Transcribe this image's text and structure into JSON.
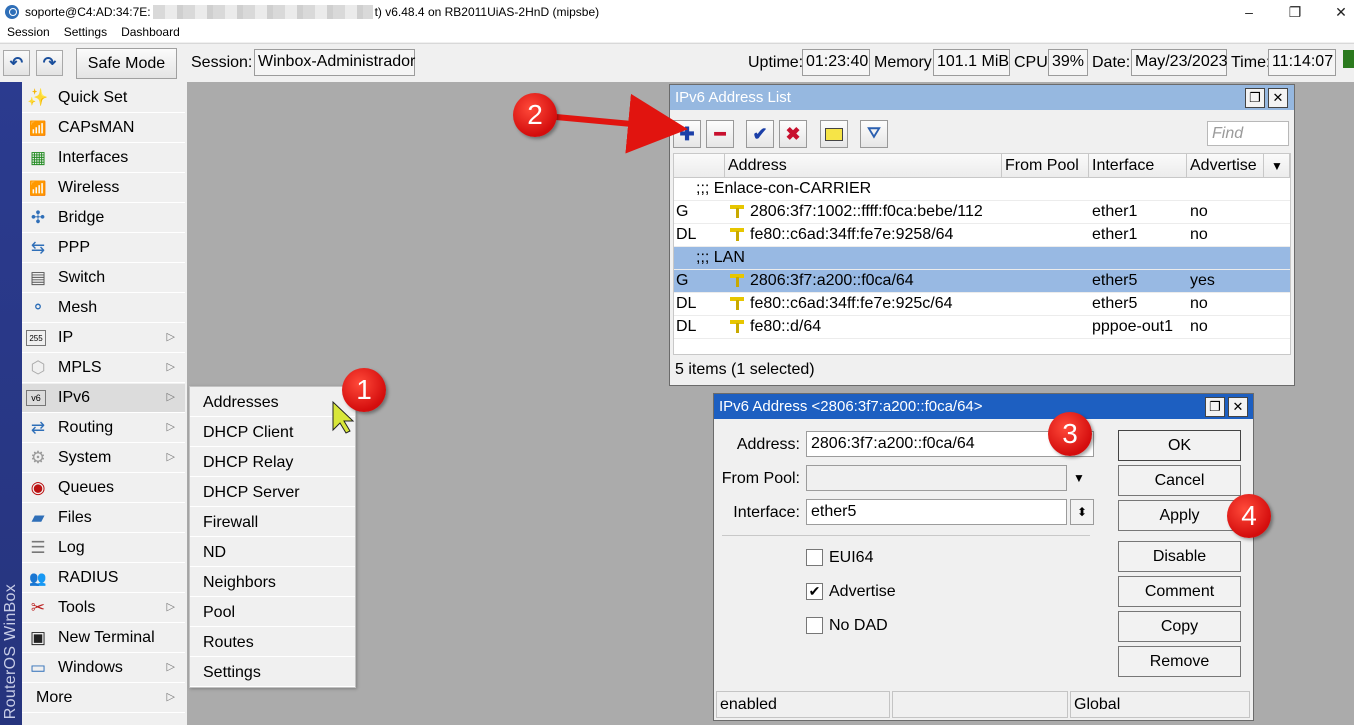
{
  "window": {
    "title_prefix": "soporte@C4:AD:34:7E:",
    "title_suffix": "t) v6.48.4 on RB2011UiAS-2HnD (mipsbe)",
    "minimize": "–",
    "maximize": "❐",
    "close": "✕"
  },
  "menubar": {
    "items": [
      "Session",
      "Settings",
      "Dashboard"
    ]
  },
  "toolbar": {
    "undo_icon": "↶",
    "redo_icon": "↷",
    "safe_mode": "Safe Mode",
    "session_label": "Session:",
    "session_value": "Winbox-Administrador",
    "uptime_label": "Uptime:",
    "uptime_value": "01:23:40",
    "memory_label": "Memory:",
    "memory_value": "101.1 MiB",
    "cpu_label": "CPU:",
    "cpu_value": "39%",
    "date_label": "Date:",
    "date_value": "May/23/2023",
    "time_label": "Time:",
    "time_value": "11:14:07"
  },
  "brand": "RouterOS WinBox",
  "sidebar": {
    "items": [
      {
        "label": "Quick Set",
        "icon": "wand-icon",
        "glyph": "✨",
        "submenu": false
      },
      {
        "label": "CAPsMAN",
        "icon": "capsman-icon",
        "glyph": "📶",
        "submenu": false
      },
      {
        "label": "Interfaces",
        "icon": "interfaces-icon",
        "glyph": "▦",
        "submenu": false
      },
      {
        "label": "Wireless",
        "icon": "wireless-icon",
        "glyph": "📶",
        "submenu": false
      },
      {
        "label": "Bridge",
        "icon": "bridge-icon",
        "glyph": "✣",
        "submenu": false
      },
      {
        "label": "PPP",
        "icon": "ppp-icon",
        "glyph": "⇆",
        "submenu": false
      },
      {
        "label": "Switch",
        "icon": "switch-icon",
        "glyph": "▤",
        "submenu": false
      },
      {
        "label": "Mesh",
        "icon": "mesh-icon",
        "glyph": "⚬",
        "submenu": false
      },
      {
        "label": "IP",
        "icon": "ip-icon",
        "glyph": "255",
        "submenu": true
      },
      {
        "label": "MPLS",
        "icon": "mpls-icon",
        "glyph": "⬡",
        "submenu": true
      },
      {
        "label": "IPv6",
        "icon": "ipv6-icon",
        "glyph": "v6",
        "submenu": true
      },
      {
        "label": "Routing",
        "icon": "routing-icon",
        "glyph": "⇄",
        "submenu": true
      },
      {
        "label": "System",
        "icon": "gear-icon",
        "glyph": "⚙",
        "submenu": true
      },
      {
        "label": "Queues",
        "icon": "queues-icon",
        "glyph": "◉",
        "submenu": false
      },
      {
        "label": "Files",
        "icon": "folder-icon",
        "glyph": "▰",
        "submenu": false
      },
      {
        "label": "Log",
        "icon": "log-icon",
        "glyph": "☰",
        "submenu": false
      },
      {
        "label": "RADIUS",
        "icon": "radius-icon",
        "glyph": "👥",
        "submenu": false
      },
      {
        "label": "Tools",
        "icon": "tools-icon",
        "glyph": "✂",
        "submenu": true
      },
      {
        "label": "New Terminal",
        "icon": "terminal-icon",
        "glyph": "▣",
        "submenu": false
      },
      {
        "label": "Windows",
        "icon": "windows-icon",
        "glyph": "▭",
        "submenu": true
      },
      {
        "label": "More",
        "icon": "",
        "glyph": "",
        "submenu": true
      }
    ],
    "submenu_arrow": "▷"
  },
  "ipv6_submenu": {
    "items": [
      "Addresses",
      "DHCP Client",
      "DHCP Relay",
      "DHCP Server",
      "Firewall",
      "ND",
      "Neighbors",
      "Pool",
      "Routes",
      "Settings"
    ]
  },
  "address_list": {
    "title": "IPv6 Address List",
    "find_placeholder": "Find",
    "columns": [
      "Address",
      "From Pool",
      "Interface",
      "Advertise"
    ],
    "rows": [
      {
        "type": "comment",
        "text": ";;; Enlace-con-CARRIER"
      },
      {
        "type": "row",
        "flags": "G",
        "address": "2806:3f7:1002::ffff:f0ca:bebe/112",
        "pool": "",
        "interface": "ether1",
        "advertise": "no",
        "selected": false
      },
      {
        "type": "row",
        "flags": "DL",
        "address": "fe80::c6ad:34ff:fe7e:9258/64",
        "pool": "",
        "interface": "ether1",
        "advertise": "no",
        "selected": false
      },
      {
        "type": "comment",
        "text": ";;; LAN"
      },
      {
        "type": "row",
        "flags": "G",
        "address": "2806:3f7:a200::f0ca/64",
        "pool": "",
        "interface": "ether5",
        "advertise": "yes",
        "selected": true
      },
      {
        "type": "row",
        "flags": "DL",
        "address": "fe80::c6ad:34ff:fe7e:925c/64",
        "pool": "",
        "interface": "ether5",
        "advertise": "no",
        "selected": false
      },
      {
        "type": "row",
        "flags": "DL",
        "address": "fe80::d/64",
        "pool": "",
        "interface": "pppoe-out1",
        "advertise": "no",
        "selected": false
      }
    ],
    "status": "5 items (1 selected)"
  },
  "address_dialog": {
    "title": "IPv6 Address <2806:3f7:a200::f0ca/64>",
    "address_label": "Address:",
    "address_value": "2806:3f7:a200::f0ca/64",
    "pool_label": "From Pool:",
    "pool_value": "",
    "interface_label": "Interface:",
    "interface_value": "ether5",
    "eui64_label": "EUI64",
    "eui64_checked": false,
    "advertise_label": "Advertise",
    "advertise_checked": true,
    "nodad_label": "No DAD",
    "nodad_checked": false,
    "buttons": [
      "OK",
      "Cancel",
      "Apply",
      "Disable",
      "Comment",
      "Copy",
      "Remove"
    ],
    "status": [
      "enabled",
      "",
      "Global"
    ]
  },
  "annotations": [
    "1",
    "2",
    "3",
    "4"
  ],
  "colors": {
    "window_title": "#96b8e0",
    "selected_row": "#98b9e3",
    "sidebar_strip": "#2b3b8f",
    "annotation_red": "#d40d0d"
  }
}
